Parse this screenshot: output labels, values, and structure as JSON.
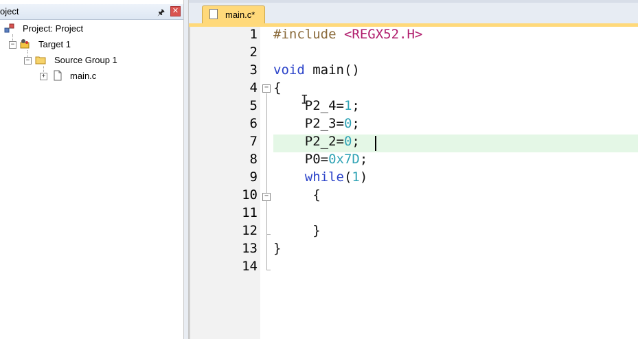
{
  "project_panel": {
    "title": "oject",
    "pin_icon": "pin-icon",
    "close_icon": "close-icon",
    "tree": {
      "root": "Project: Project",
      "target": "Target 1",
      "group": "Source Group 1",
      "file": "main.c"
    }
  },
  "editor": {
    "tab_label": "main.c*",
    "line_numbers": [
      "1",
      "2",
      "3",
      "4",
      "5",
      "6",
      "7",
      "8",
      "9",
      "10",
      "11",
      "12",
      "13",
      "14"
    ],
    "lines": {
      "l1_directive": "#include",
      "l1_header": " <REGX52.H>",
      "l3_void": "void",
      "l3_rest": " main()",
      "l4": "{",
      "l5_a": "    P2_4=",
      "l5_b": "1",
      "l5_c": ";",
      "l6_a": "    P2_3=",
      "l6_b": "0",
      "l6_c": ";",
      "l7_a": "    P2_2=",
      "l7_b": "0",
      "l7_c": ";",
      "l8_a": "    P0=",
      "l8_b": "0x7D",
      "l8_c": ";",
      "l9_kw": "while",
      "l9_a": "(",
      "l9_b": "1",
      "l9_c": ")",
      "l10": "     {",
      "l12": "     }",
      "l13": "}"
    },
    "colors": {
      "keyword": "#2b43c9",
      "number": "#2fa3b5",
      "string": "#b01c6c",
      "current_line": "#e4f7e6",
      "tab_active": "#ffd97a"
    }
  }
}
